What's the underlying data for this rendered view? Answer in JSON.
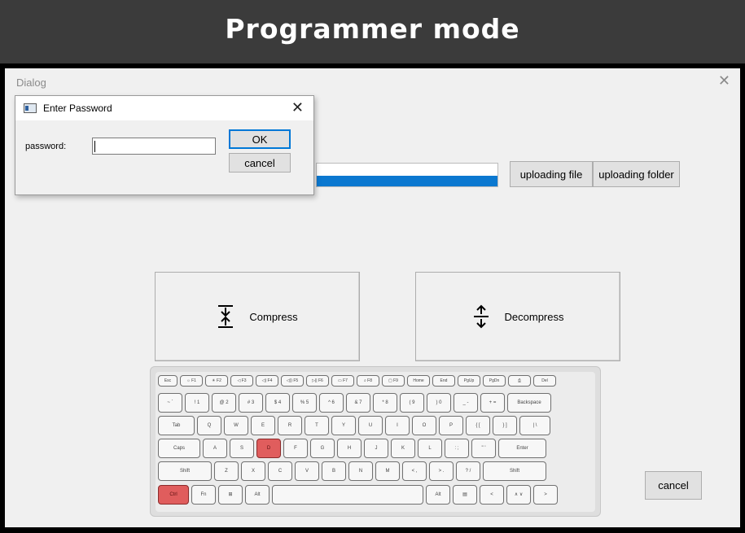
{
  "banner": {
    "title": "Programmer mode"
  },
  "dialog": {
    "title": "Dialog",
    "close": "✕",
    "upload_file_label": "uploading file",
    "upload_folder_label": "uploading folder",
    "progress_fraction": 0.0,
    "compress_label": "Compress",
    "decompress_label": "Decompress",
    "cancel_label": "cancel"
  },
  "password_dialog": {
    "title": "Enter Password",
    "close": "✕",
    "label": "password:",
    "value": "",
    "ok_label": "OK",
    "cancel_label": "cancel"
  },
  "keyboard": {
    "highlight_color": "#e05d5d",
    "rows": [
      {
        "keys": [
          "Esc",
          "☼ F1",
          "☀ F2",
          "◁ F3",
          "◁) F4",
          "◁)) F5",
          "▷|| F6",
          "▭ F7",
          "⌕ F8",
          "▢ F9",
          "Home",
          "End",
          "PgUp",
          "PgDn",
          "⎙",
          "Del"
        ]
      },
      {
        "keys": [
          "~ `",
          "! 1",
          "@ 2",
          "# 3",
          "$ 4",
          "% 5",
          "^ 6",
          "& 7",
          "* 8",
          "( 9",
          ") 0",
          "_ -",
          "+ =",
          "Backspace"
        ]
      },
      {
        "keys": [
          "Tab",
          "Q",
          "W",
          "E",
          "R",
          "T",
          "Y",
          "U",
          "I",
          "O",
          "P",
          "{ [",
          "} ]",
          "| \\"
        ]
      },
      {
        "keys": [
          "Caps",
          "A",
          "S",
          "D",
          "F",
          "G",
          "H",
          "J",
          "K",
          "L",
          ": ;",
          "\" '",
          "Enter"
        ]
      },
      {
        "keys": [
          "Shift",
          "Z",
          "X",
          "C",
          "V",
          "B",
          "N",
          "M",
          "< ,",
          "> .",
          "? /",
          "Shift"
        ]
      },
      {
        "keys": [
          "Ctrl",
          "Fn",
          "⊞",
          "Alt",
          "",
          "Alt",
          "▤",
          "<",
          "∧ ∨",
          ">"
        ]
      }
    ],
    "highlighted": [
      "D",
      "Ctrl"
    ]
  }
}
